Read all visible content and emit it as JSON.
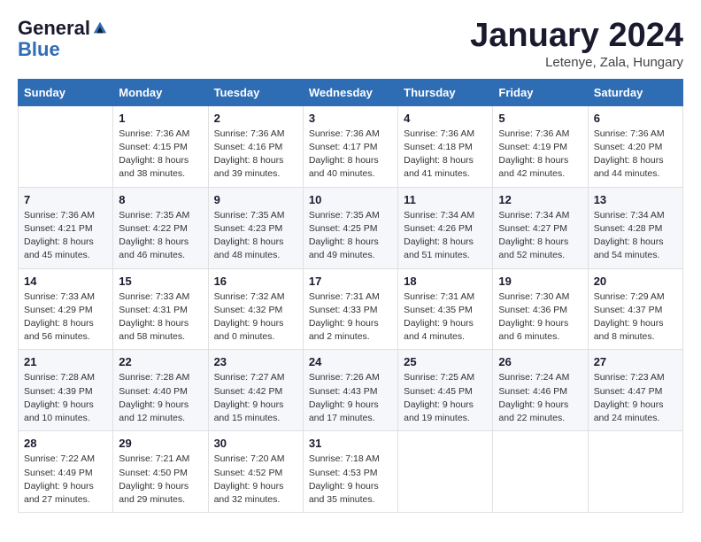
{
  "header": {
    "logo_general": "General",
    "logo_blue": "Blue",
    "month_title": "January 2024",
    "subtitle": "Letenye, Zala, Hungary"
  },
  "weekdays": [
    "Sunday",
    "Monday",
    "Tuesday",
    "Wednesday",
    "Thursday",
    "Friday",
    "Saturday"
  ],
  "weeks": [
    [
      {
        "num": "",
        "sunrise": "",
        "sunset": "",
        "daylight": ""
      },
      {
        "num": "1",
        "sunrise": "Sunrise: 7:36 AM",
        "sunset": "Sunset: 4:15 PM",
        "daylight": "Daylight: 8 hours and 38 minutes."
      },
      {
        "num": "2",
        "sunrise": "Sunrise: 7:36 AM",
        "sunset": "Sunset: 4:16 PM",
        "daylight": "Daylight: 8 hours and 39 minutes."
      },
      {
        "num": "3",
        "sunrise": "Sunrise: 7:36 AM",
        "sunset": "Sunset: 4:17 PM",
        "daylight": "Daylight: 8 hours and 40 minutes."
      },
      {
        "num": "4",
        "sunrise": "Sunrise: 7:36 AM",
        "sunset": "Sunset: 4:18 PM",
        "daylight": "Daylight: 8 hours and 41 minutes."
      },
      {
        "num": "5",
        "sunrise": "Sunrise: 7:36 AM",
        "sunset": "Sunset: 4:19 PM",
        "daylight": "Daylight: 8 hours and 42 minutes."
      },
      {
        "num": "6",
        "sunrise": "Sunrise: 7:36 AM",
        "sunset": "Sunset: 4:20 PM",
        "daylight": "Daylight: 8 hours and 44 minutes."
      }
    ],
    [
      {
        "num": "7",
        "sunrise": "Sunrise: 7:36 AM",
        "sunset": "Sunset: 4:21 PM",
        "daylight": "Daylight: 8 hours and 45 minutes."
      },
      {
        "num": "8",
        "sunrise": "Sunrise: 7:35 AM",
        "sunset": "Sunset: 4:22 PM",
        "daylight": "Daylight: 8 hours and 46 minutes."
      },
      {
        "num": "9",
        "sunrise": "Sunrise: 7:35 AM",
        "sunset": "Sunset: 4:23 PM",
        "daylight": "Daylight: 8 hours and 48 minutes."
      },
      {
        "num": "10",
        "sunrise": "Sunrise: 7:35 AM",
        "sunset": "Sunset: 4:25 PM",
        "daylight": "Daylight: 8 hours and 49 minutes."
      },
      {
        "num": "11",
        "sunrise": "Sunrise: 7:34 AM",
        "sunset": "Sunset: 4:26 PM",
        "daylight": "Daylight: 8 hours and 51 minutes."
      },
      {
        "num": "12",
        "sunrise": "Sunrise: 7:34 AM",
        "sunset": "Sunset: 4:27 PM",
        "daylight": "Daylight: 8 hours and 52 minutes."
      },
      {
        "num": "13",
        "sunrise": "Sunrise: 7:34 AM",
        "sunset": "Sunset: 4:28 PM",
        "daylight": "Daylight: 8 hours and 54 minutes."
      }
    ],
    [
      {
        "num": "14",
        "sunrise": "Sunrise: 7:33 AM",
        "sunset": "Sunset: 4:29 PM",
        "daylight": "Daylight: 8 hours and 56 minutes."
      },
      {
        "num": "15",
        "sunrise": "Sunrise: 7:33 AM",
        "sunset": "Sunset: 4:31 PM",
        "daylight": "Daylight: 8 hours and 58 minutes."
      },
      {
        "num": "16",
        "sunrise": "Sunrise: 7:32 AM",
        "sunset": "Sunset: 4:32 PM",
        "daylight": "Daylight: 9 hours and 0 minutes."
      },
      {
        "num": "17",
        "sunrise": "Sunrise: 7:31 AM",
        "sunset": "Sunset: 4:33 PM",
        "daylight": "Daylight: 9 hours and 2 minutes."
      },
      {
        "num": "18",
        "sunrise": "Sunrise: 7:31 AM",
        "sunset": "Sunset: 4:35 PM",
        "daylight": "Daylight: 9 hours and 4 minutes."
      },
      {
        "num": "19",
        "sunrise": "Sunrise: 7:30 AM",
        "sunset": "Sunset: 4:36 PM",
        "daylight": "Daylight: 9 hours and 6 minutes."
      },
      {
        "num": "20",
        "sunrise": "Sunrise: 7:29 AM",
        "sunset": "Sunset: 4:37 PM",
        "daylight": "Daylight: 9 hours and 8 minutes."
      }
    ],
    [
      {
        "num": "21",
        "sunrise": "Sunrise: 7:28 AM",
        "sunset": "Sunset: 4:39 PM",
        "daylight": "Daylight: 9 hours and 10 minutes."
      },
      {
        "num": "22",
        "sunrise": "Sunrise: 7:28 AM",
        "sunset": "Sunset: 4:40 PM",
        "daylight": "Daylight: 9 hours and 12 minutes."
      },
      {
        "num": "23",
        "sunrise": "Sunrise: 7:27 AM",
        "sunset": "Sunset: 4:42 PM",
        "daylight": "Daylight: 9 hours and 15 minutes."
      },
      {
        "num": "24",
        "sunrise": "Sunrise: 7:26 AM",
        "sunset": "Sunset: 4:43 PM",
        "daylight": "Daylight: 9 hours and 17 minutes."
      },
      {
        "num": "25",
        "sunrise": "Sunrise: 7:25 AM",
        "sunset": "Sunset: 4:45 PM",
        "daylight": "Daylight: 9 hours and 19 minutes."
      },
      {
        "num": "26",
        "sunrise": "Sunrise: 7:24 AM",
        "sunset": "Sunset: 4:46 PM",
        "daylight": "Daylight: 9 hours and 22 minutes."
      },
      {
        "num": "27",
        "sunrise": "Sunrise: 7:23 AM",
        "sunset": "Sunset: 4:47 PM",
        "daylight": "Daylight: 9 hours and 24 minutes."
      }
    ],
    [
      {
        "num": "28",
        "sunrise": "Sunrise: 7:22 AM",
        "sunset": "Sunset: 4:49 PM",
        "daylight": "Daylight: 9 hours and 27 minutes."
      },
      {
        "num": "29",
        "sunrise": "Sunrise: 7:21 AM",
        "sunset": "Sunset: 4:50 PM",
        "daylight": "Daylight: 9 hours and 29 minutes."
      },
      {
        "num": "30",
        "sunrise": "Sunrise: 7:20 AM",
        "sunset": "Sunset: 4:52 PM",
        "daylight": "Daylight: 9 hours and 32 minutes."
      },
      {
        "num": "31",
        "sunrise": "Sunrise: 7:18 AM",
        "sunset": "Sunset: 4:53 PM",
        "daylight": "Daylight: 9 hours and 35 minutes."
      },
      {
        "num": "",
        "sunrise": "",
        "sunset": "",
        "daylight": ""
      },
      {
        "num": "",
        "sunrise": "",
        "sunset": "",
        "daylight": ""
      },
      {
        "num": "",
        "sunrise": "",
        "sunset": "",
        "daylight": ""
      }
    ]
  ]
}
